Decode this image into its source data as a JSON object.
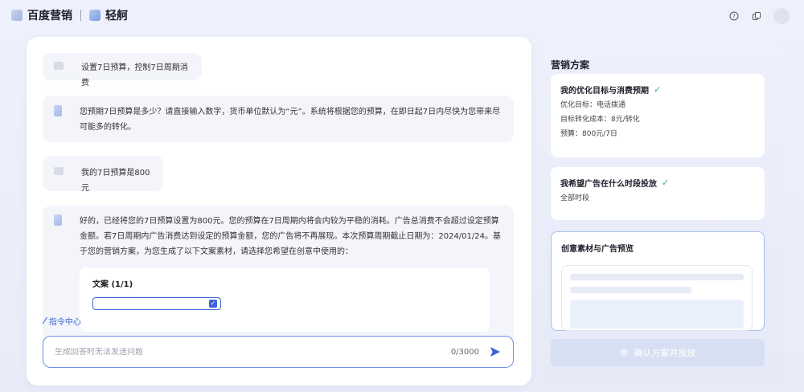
{
  "header": {
    "brand": "百度营销",
    "product": "轻舸",
    "icons": [
      "help-icon",
      "copy-icon"
    ]
  },
  "chat": {
    "messages": [
      {
        "role": "user",
        "text": "设置7日预算，控制7日周期消费"
      },
      {
        "role": "assistant",
        "text": "您预期7日预算是多少？请直接输入数字，货币单位默认为“元”。系统将根据您的预算，在即日起7日内尽快为您带来尽可能多的转化。"
      },
      {
        "role": "user",
        "text": "我的7日预算是800元"
      },
      {
        "role": "assistant",
        "text": "好的，已经将您的7日预算设置为800元。您的预算在7日周期内将会内较为平稳的消耗。广告总消费不会超过设定预算金额。若7日周期内广告消费达到设定的预算金额，您的广告将不再展现。本次预算周期截止日期为：2024/01/24。基于您的营销方案，为您生成了以下文案素材，请选择您希望在创意中使用的："
      }
    ],
    "copy_card": {
      "title": "文案 (1/1)"
    },
    "command_center": "指令中心",
    "input": {
      "placeholder": "生成回答时无法发送问题",
      "value": "",
      "counter": "0/3000"
    }
  },
  "plan": {
    "title": "营销方案",
    "cards": [
      {
        "title": "我的优化目标与消费预期",
        "lines": [
          "优化目标：电话拨通",
          "目标转化成本：8元/转化",
          "预算：800元/7日"
        ]
      },
      {
        "title": "我希望广告在什么时段投放",
        "lines": [
          "全部时段"
        ]
      },
      {
        "title": "创意素材与广告预览",
        "lines": []
      }
    ],
    "confirm_button": "确认方案并投放"
  },
  "colors": {
    "accent": "#3d63d6",
    "check": "#2bb673"
  }
}
